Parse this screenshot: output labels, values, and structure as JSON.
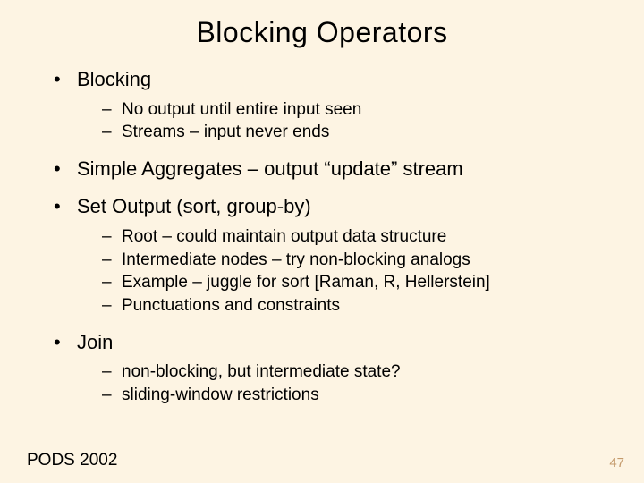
{
  "title": "Blocking Operators",
  "bullets": {
    "b1": {
      "text": "Blocking",
      "sub": [
        "No output until entire input seen",
        "Streams – input never ends"
      ]
    },
    "b2": {
      "text": "Simple Aggregates – output “update” stream"
    },
    "b3": {
      "text": "Set Output (sort, group-by)",
      "sub": [
        "Root – could maintain output data structure",
        "Intermediate nodes – try non-blocking analogs",
        "Example – juggle for sort [Raman, R, Hellerstein]",
        "Punctuations and constraints"
      ]
    },
    "b4": {
      "text": "Join",
      "sub": [
        "non-blocking, but intermediate state?",
        "sliding-window restrictions"
      ]
    }
  },
  "footer": {
    "left": "PODS 2002",
    "right": "47"
  }
}
